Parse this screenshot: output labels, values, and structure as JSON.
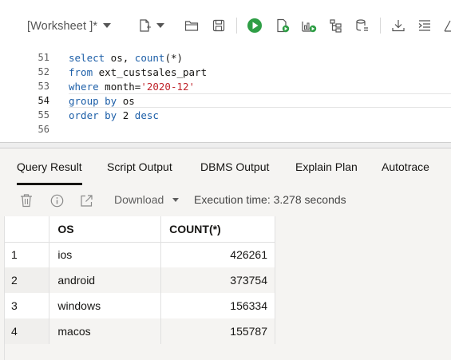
{
  "toolbar": {
    "worksheet_label": "[Worksheet ]*",
    "icons": [
      "new-worksheet-icon",
      "open-folder-icon",
      "save-icon",
      "run-statement-icon",
      "run-script-icon",
      "explain-plan-icon",
      "autotrace-icon",
      "sql-tuning-icon",
      "download-icon",
      "format-icon",
      "clear-icon"
    ],
    "run_color": "#2e9e45"
  },
  "editor": {
    "line_numbers": [
      "51",
      "52",
      "53",
      "54",
      "55",
      "56"
    ],
    "active_line": "54",
    "lines": [
      {
        "kw1": "select",
        "rest1": " os, ",
        "kw2": "count",
        "rest2": "(*)"
      },
      {
        "kw1": "from",
        "rest1": " ext_custsales_part"
      },
      {
        "kw1": "where",
        "rest1": " month=",
        "str": "'2020-12'"
      },
      {
        "kw1": "group by",
        "rest1": " os"
      },
      {
        "kw1": "order by",
        "rest1": " 2 ",
        "kw2": "desc"
      },
      {
        "kw1": "",
        "rest1": ""
      }
    ]
  },
  "result_tabs": [
    {
      "label": "Query Result",
      "active": true
    },
    {
      "label": "Script Output",
      "active": false
    },
    {
      "label": "DBMS Output",
      "active": false
    },
    {
      "label": "Explain Plan",
      "active": false
    },
    {
      "label": "Autotrace",
      "active": false
    }
  ],
  "result_toolbar": {
    "download_label": "Download",
    "execution_time": "Execution time: 3.278 seconds"
  },
  "results": {
    "columns": [
      "OS",
      "COUNT(*)"
    ],
    "rows": [
      {
        "n": "1",
        "os": "ios",
        "count": "426261"
      },
      {
        "n": "2",
        "os": "android",
        "count": "373754"
      },
      {
        "n": "3",
        "os": "windows",
        "count": "156334"
      },
      {
        "n": "4",
        "os": "macos",
        "count": "155787"
      }
    ]
  }
}
